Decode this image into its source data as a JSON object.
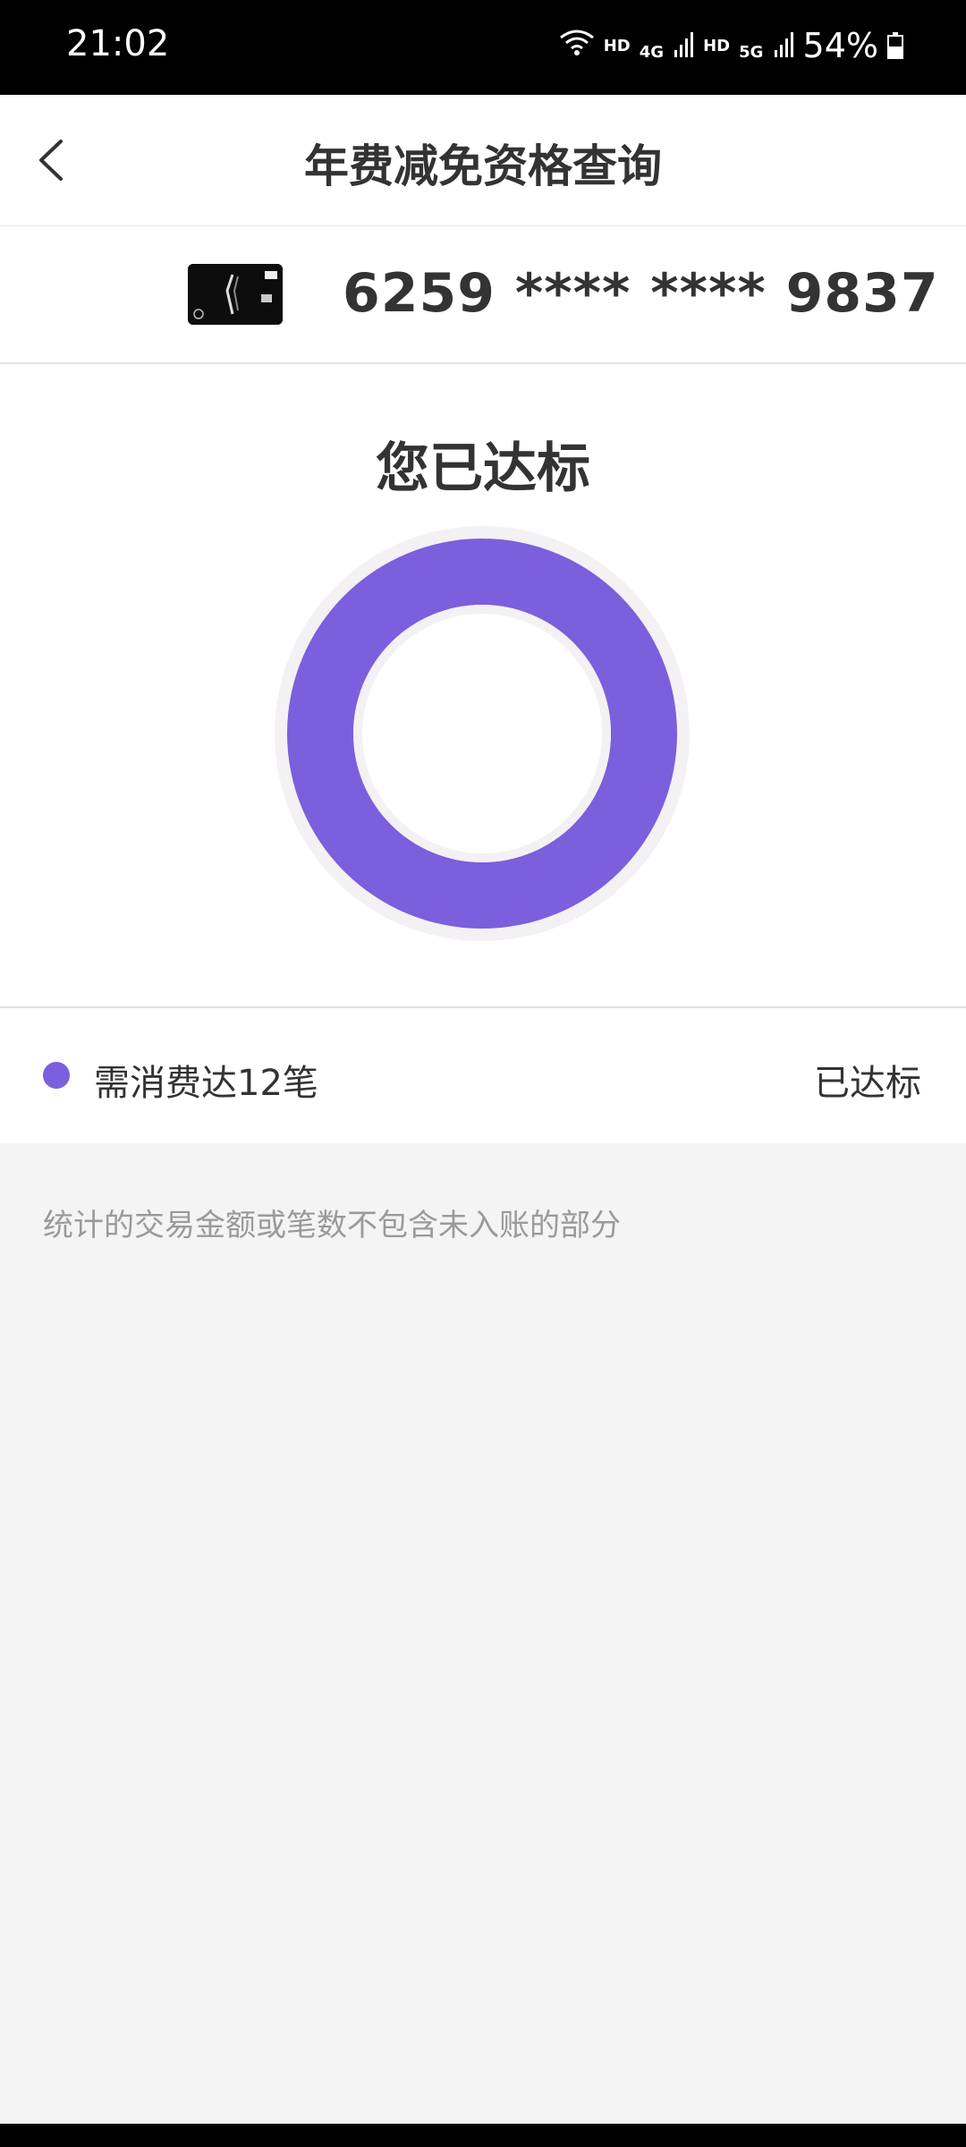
{
  "status_bar": {
    "time": "21:02",
    "hd1": "HD",
    "net1": "4G",
    "hd2": "HD",
    "net2": "5G",
    "battery": "54%",
    "battery_level": 0.54
  },
  "header": {
    "title": "年费减免资格查询",
    "back_icon": "chevron-left-icon"
  },
  "card": {
    "number": "6259 **** **** 9837"
  },
  "status": {
    "heading": "您已达标",
    "progress": 1.0,
    "ring_color": "#7B5FDC",
    "ring_bg_color": "#F3F1F4"
  },
  "criteria": {
    "label": "需消费达12笔",
    "status": "已达标",
    "dot_color": "#7B5FDC"
  },
  "footnote": "统计的交易金额或笔数不包含未入账的部分"
}
